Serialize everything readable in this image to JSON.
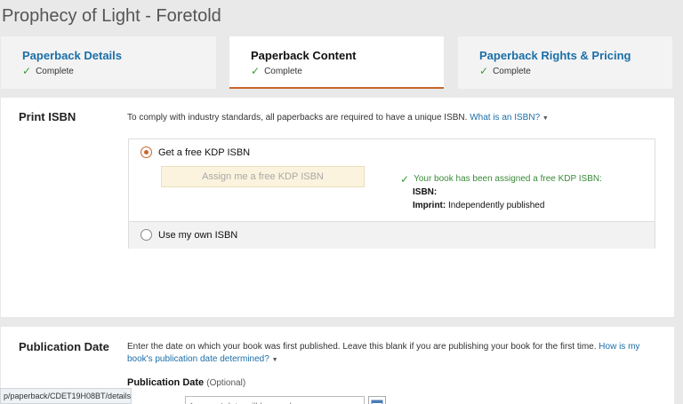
{
  "page": {
    "title": "Prophecy of Light - Foretold"
  },
  "tabs": [
    {
      "label": "Paperback Details",
      "status": "Complete"
    },
    {
      "label": "Paperback Content",
      "status": "Complete"
    },
    {
      "label": "Paperback Rights & Pricing",
      "status": "Complete"
    }
  ],
  "print_isbn": {
    "title": "Print ISBN",
    "description": "To comply with industry standards, all paperbacks are required to have a unique ISBN.",
    "help_link": "What is an ISBN?",
    "free_option_label": "Get a free KDP ISBN",
    "assign_button": "Assign me a free KDP ISBN",
    "assigned_message": "Your book has been assigned a free KDP ISBN:",
    "isbn_label": "ISBN:",
    "isbn_value": "",
    "imprint_label": "Imprint:",
    "imprint_value": "Independently published",
    "own_option_label": "Use my own ISBN"
  },
  "publication_date": {
    "title": "Publication Date",
    "description": "Enter the date on which your book was first published. Leave this blank if you are publishing your book for the first time.",
    "help_link_part1": "How is my",
    "help_link_part2": "book's publication date determined?",
    "field_label": "Publication Date",
    "field_optional": "(Optional)",
    "input_placeholder": "Amazon' date will be used"
  },
  "status_bar": {
    "url": "p/paperback/CDET19H08BT/details"
  },
  "colors": {
    "accent": "#c7662b",
    "link": "#1b6fa8",
    "success": "#3a9a3a"
  },
  "icons": {
    "check": "check-icon",
    "calendar": "calendar-icon",
    "caret": "caret-down-icon"
  }
}
